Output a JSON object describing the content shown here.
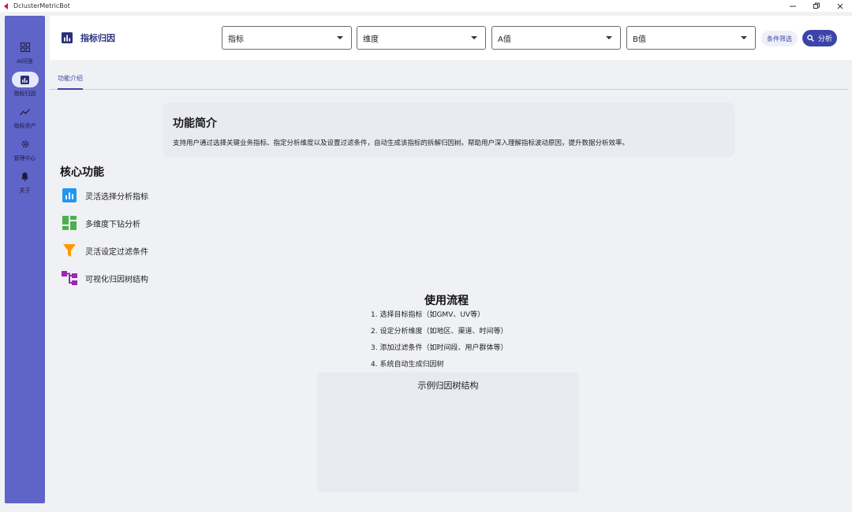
{
  "window": {
    "title": "DclusterMetricBot",
    "controls": [
      "minimize-icon",
      "restore-icon",
      "close-icon"
    ]
  },
  "sidebar": {
    "items": [
      {
        "label": "AI问答",
        "icon": "grid-icon",
        "active": false
      },
      {
        "label": "指标归因",
        "icon": "bar-chart-icon",
        "active": true
      },
      {
        "label": "指标资产",
        "icon": "trend-icon",
        "active": false
      },
      {
        "label": "管理中心",
        "icon": "gear-icon",
        "active": false
      },
      {
        "label": "关于",
        "icon": "bell-icon",
        "active": false
      }
    ]
  },
  "header": {
    "title": "指标归因",
    "selects": [
      {
        "placeholder": "指标"
      },
      {
        "placeholder": "维度"
      },
      {
        "placeholder": "A值"
      },
      {
        "placeholder": "B值"
      }
    ],
    "filter_label": "条件筛选",
    "analyze_label": "分析"
  },
  "tabs": [
    {
      "label": "功能介绍",
      "active": true
    }
  ],
  "intro": {
    "title": "功能简介",
    "text": "支持用户通过选择关键业务指标、指定分析维度以及设置过滤条件，自动生成该指标的拆解归因树。帮助用户深入理解指标波动原因，提升数据分析效率。"
  },
  "core": {
    "title": "核心功能",
    "features": [
      {
        "label": "灵活选择分析指标",
        "icon": "bar-chart-icon",
        "color": "#2196f3"
      },
      {
        "label": "多维度下钻分析",
        "icon": "dashboard-icon",
        "color": "#4caf50"
      },
      {
        "label": "灵活设定过滤条件",
        "icon": "filter-icon",
        "color": "#ff9800"
      },
      {
        "label": "可视化归因树结构",
        "icon": "tree-structure-icon",
        "color": "#9c27b0"
      }
    ]
  },
  "process": {
    "title": "使用流程",
    "steps": [
      "1. 选择目标指标（如GMV、UV等）",
      "2. 设定分析维度（如地区、渠道、时间等）",
      "3. 添加过滤条件（如时间段、用户群体等）",
      "4. 系统自动生成归因树"
    ]
  },
  "example": {
    "title": "示例归因树结构"
  },
  "colors": {
    "sidebar": "#5f64c8",
    "accent": "#3d44a8"
  }
}
